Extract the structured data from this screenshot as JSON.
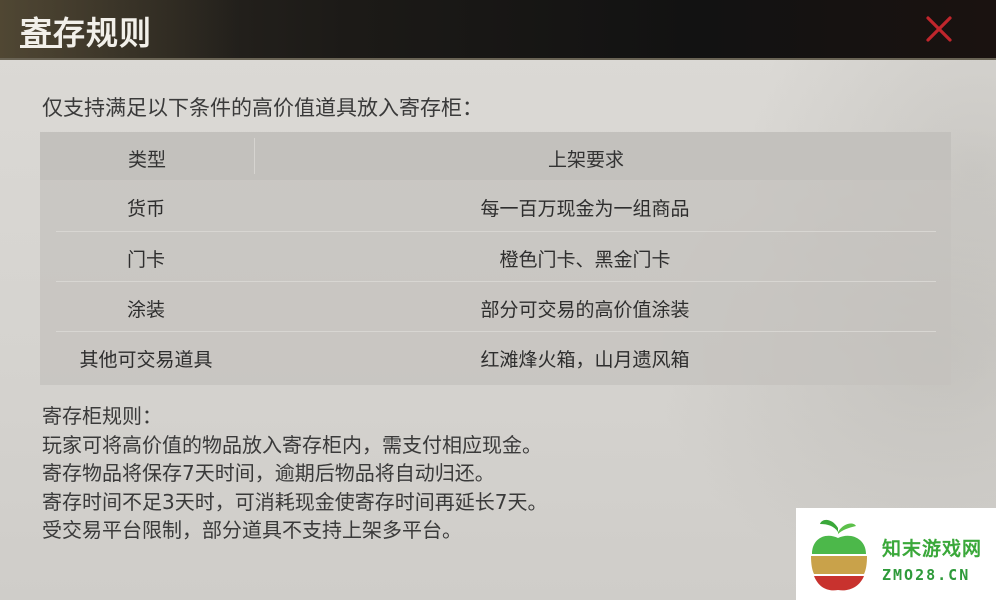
{
  "dialog": {
    "title": "寄存规则",
    "close_icon": "close-x-icon",
    "accent_color": "#c0262c"
  },
  "intro": "仅支持满足以下条件的高价值道具放入寄存柜：",
  "table": {
    "headers": {
      "type": "类型",
      "requirement": "上架要求"
    },
    "rows": [
      {
        "type": "货币",
        "requirement": "每一百万现金为一组商品"
      },
      {
        "type": "门卡",
        "requirement": "橙色门卡、黑金门卡"
      },
      {
        "type": "涂装",
        "requirement": "部分可交易的高价值涂装"
      },
      {
        "type": "其他可交易道具",
        "requirement": "红滩烽火箱，山月遗风箱"
      }
    ]
  },
  "rules": {
    "heading": "寄存柜规则：",
    "lines": [
      "玩家可将高价值的物品放入寄存柜内，需支付相应现金。",
      "寄存物品将保存7天时间，逾期后物品将自动归还。",
      "寄存时间不足3天时，可消耗现金使寄存时间再延长7天。",
      "受交易平台限制，部分道具不支持上架多平台。"
    ]
  },
  "watermark": {
    "name": "知末游戏网",
    "url": "ZMO28.CN",
    "logo_icon": "apple-logo-icon",
    "color": "#3aa83a"
  }
}
